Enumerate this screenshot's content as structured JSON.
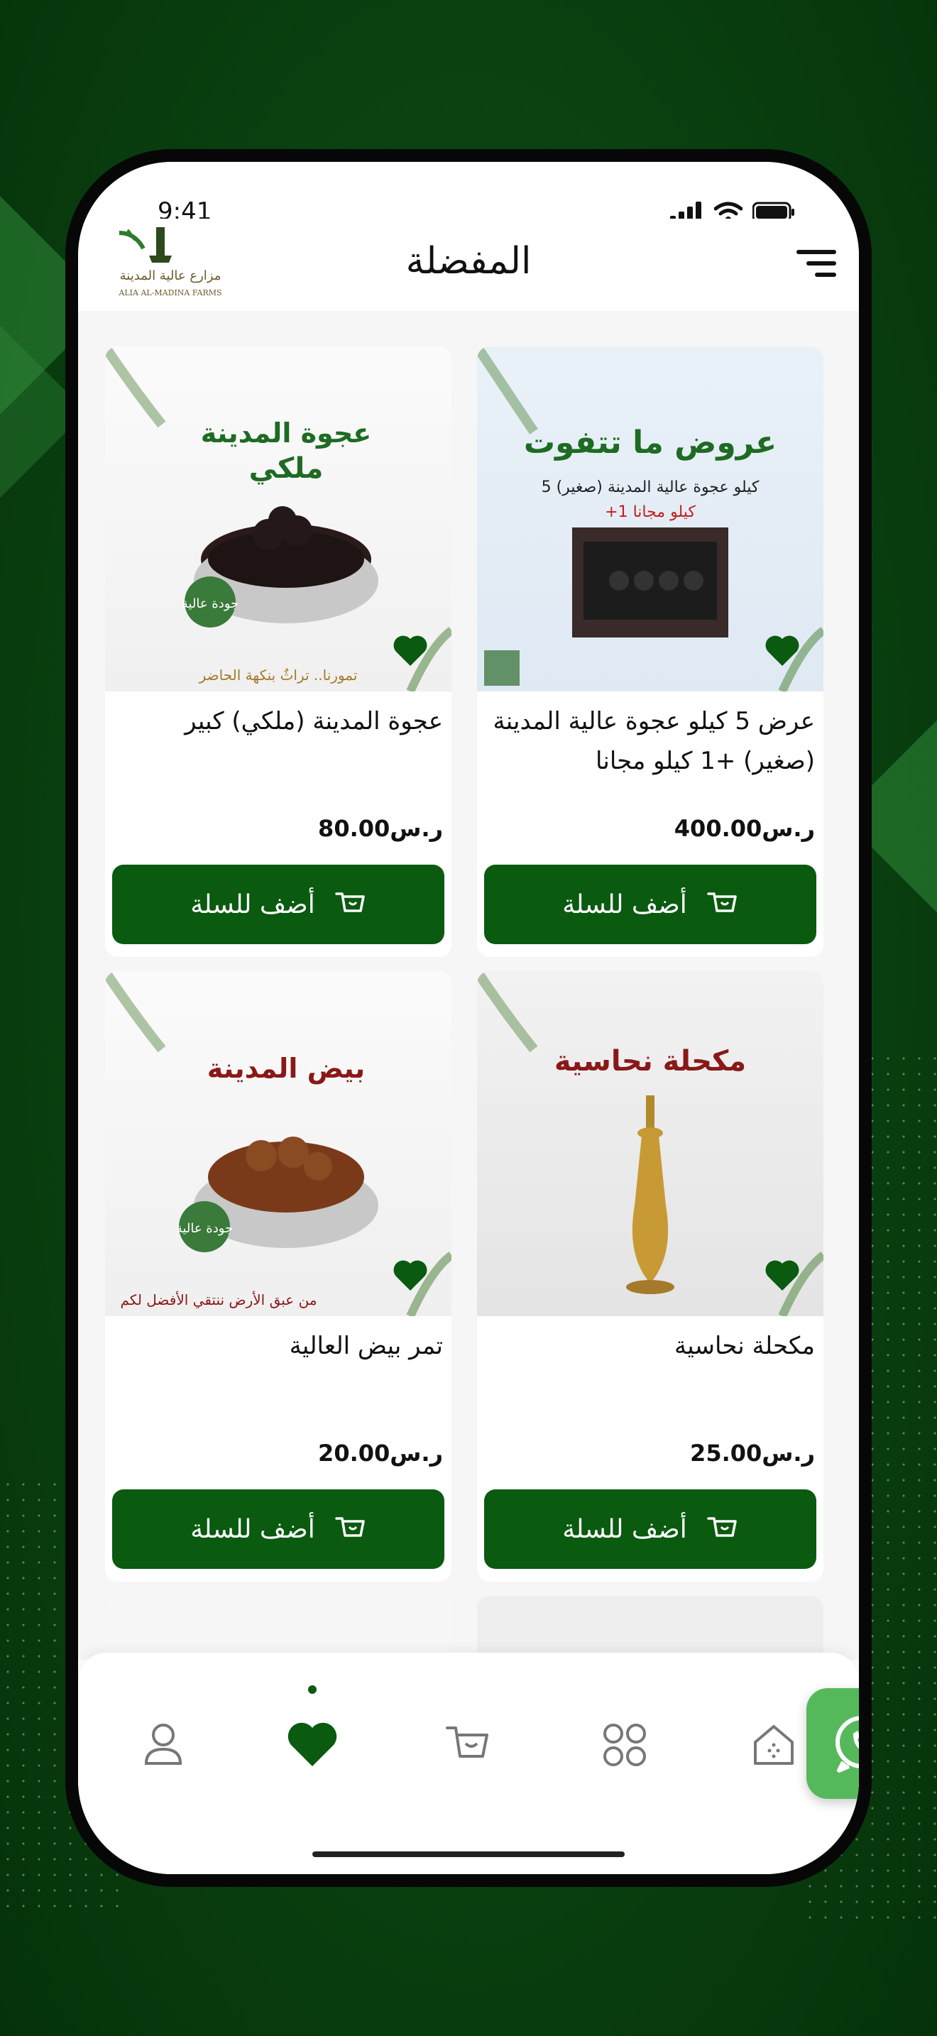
{
  "status_bar": {
    "time": "9:41"
  },
  "header": {
    "title": "المفضلة",
    "logo_text_ar": "مزارع عالية المدينة",
    "logo_text_en": "ALIA AL-MADINA FARMS"
  },
  "products": [
    {
      "name": "عرض 5 كيلو عجوة عالية المدينة (صغير) +1 كيلو مجانا",
      "price": "400.00ر.س",
      "button": "أضف للسلة",
      "image": {
        "headline": "عروض ما تتفوت",
        "line1": "5 كيلو عجوة عالية المدينة (صغير)",
        "line2": "+1 كيلو مجانا"
      }
    },
    {
      "name": "عجوة المدينة (ملكي) كبير",
      "price": "80.00ر.س",
      "button": "أضف للسلة",
      "image": {
        "headline": "عجوة المدينة",
        "sub": "ملكي",
        "badge": "جودة عالية",
        "footer": "تمورنا.. تراثٌ بنكهة الحاضر"
      }
    },
    {
      "name": "مكحلة نحاسية",
      "price": "25.00ر.س",
      "button": "أضف للسلة",
      "image": {
        "headline": "مكحلة نحاسية"
      }
    },
    {
      "name": "تمر بيض العالية",
      "price": "20.00ر.س",
      "button": "أضف للسلة",
      "image": {
        "headline": "بيض المدينة",
        "badge": "جودة عالية",
        "footer": "من عبق الأرض ننتقي الأفضل لكم"
      }
    }
  ],
  "bottom_nav": [
    "profile-icon",
    "heart-icon",
    "cart-icon",
    "grid-icon",
    "home-icon"
  ],
  "colors": {
    "primary": "#0a5a10",
    "accent_light": "#55b95c",
    "background": "#0a4412"
  }
}
